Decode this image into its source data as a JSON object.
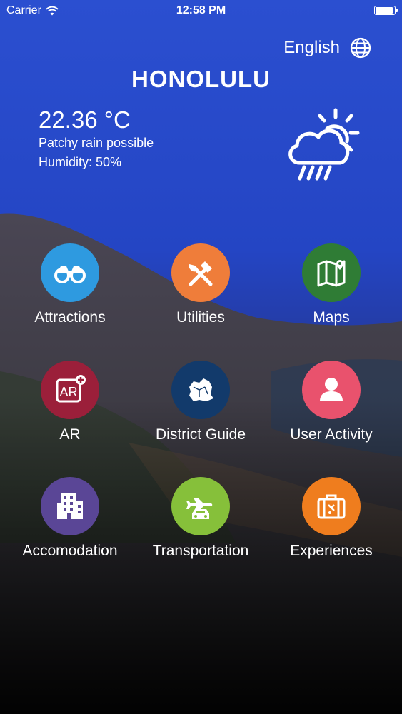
{
  "status_bar": {
    "carrier": "Carrier",
    "time": "12:58 PM"
  },
  "language": {
    "label": "English",
    "icon": "globe-icon"
  },
  "city": "HONOLULU",
  "weather": {
    "temperature": "22.36 °C",
    "description": "Patchy rain possible",
    "humidity": "Humidity: 50%",
    "icon": "rain-sun-icon"
  },
  "menu": [
    {
      "label": "Attractions",
      "icon": "binoculars-icon",
      "color": "#2e9ae0"
    },
    {
      "label": "Utilities",
      "icon": "tools-icon",
      "color": "#ef7d3a"
    },
    {
      "label": "Maps",
      "icon": "map-icon",
      "color": "#2f7c35"
    },
    {
      "label": "AR",
      "icon": "ar-icon",
      "color": "#9b1f3a"
    },
    {
      "label": "District Guide",
      "icon": "district-map-icon",
      "color": "#123a6b"
    },
    {
      "label": "User Activity",
      "icon": "user-icon",
      "color": "#e9526d"
    },
    {
      "label": "Accomodation",
      "icon": "building-icon",
      "color": "#5a4696"
    },
    {
      "label": "Transportation",
      "icon": "transport-icon",
      "color": "#86c03a"
    },
    {
      "label": "Experiences",
      "icon": "suitcase-icon",
      "color": "#ef7d1e"
    }
  ]
}
